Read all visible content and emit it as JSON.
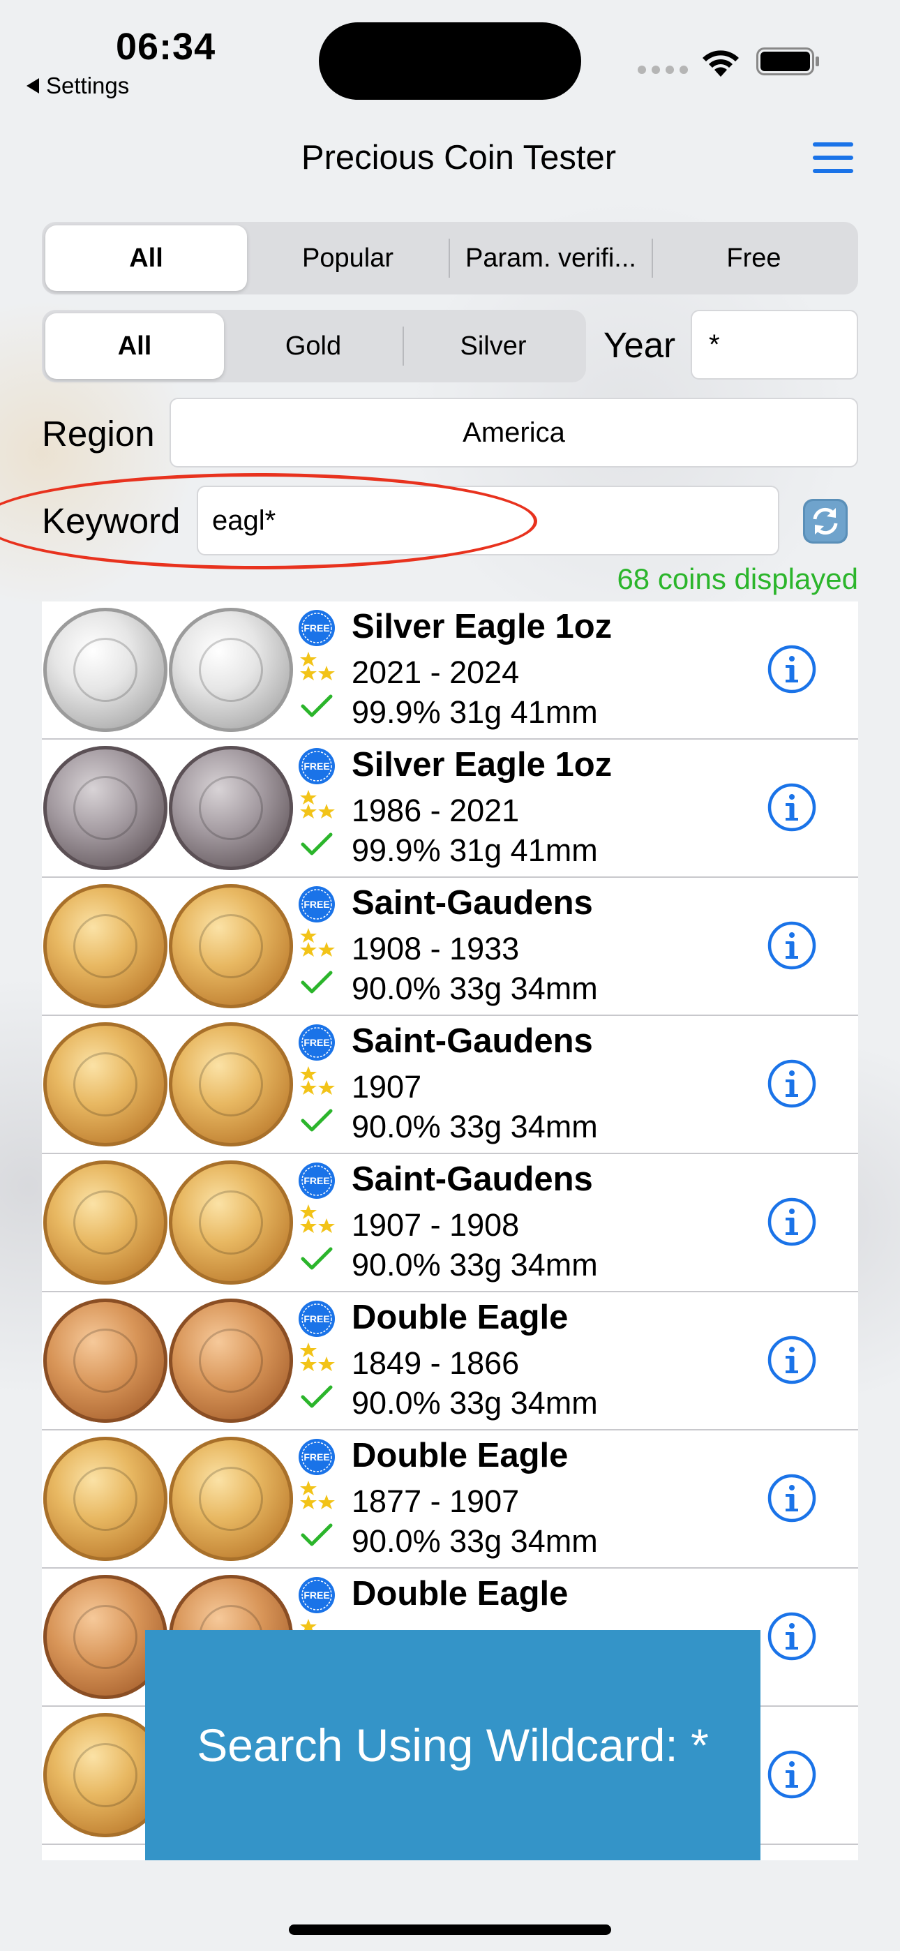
{
  "status_bar": {
    "time": "06:34",
    "back_label": "Settings"
  },
  "header": {
    "title": "Precious Coin Tester"
  },
  "filter_tabs": [
    {
      "label": "All",
      "active": true
    },
    {
      "label": "Popular",
      "active": false
    },
    {
      "label": "Param. verifi...",
      "active": false
    },
    {
      "label": "Free",
      "active": false
    }
  ],
  "metal_tabs": [
    {
      "label": "All",
      "active": true
    },
    {
      "label": "Gold",
      "active": false
    },
    {
      "label": "Silver",
      "active": false
    }
  ],
  "year": {
    "label": "Year",
    "value": "*"
  },
  "region": {
    "label": "Region",
    "value": "America"
  },
  "keyword": {
    "label": "Keyword",
    "value": "eagl*"
  },
  "count_text": "68 coins displayed",
  "badge_text": "FREE",
  "coins": [
    {
      "name": "Silver Eagle 1oz",
      "years": "2021 - 2024",
      "specs": "99.9% 31g 41mm",
      "metal": "silver"
    },
    {
      "name": "Silver Eagle 1oz",
      "years": "1986 - 2021",
      "specs": "99.9% 31g 41mm",
      "metal": "darksilver"
    },
    {
      "name": "Saint-Gaudens",
      "years": "1908 - 1933",
      "specs": "90.0% 33g 34mm",
      "metal": "gold"
    },
    {
      "name": "Saint-Gaudens",
      "years": "1907",
      "specs": "90.0% 33g 34mm",
      "metal": "gold"
    },
    {
      "name": "Saint-Gaudens",
      "years": "1907 - 1908",
      "specs": "90.0% 33g 34mm",
      "metal": "gold"
    },
    {
      "name": "Double Eagle",
      "years": "1849 - 1866",
      "specs": "90.0% 33g 34mm",
      "metal": "redgold"
    },
    {
      "name": "Double Eagle",
      "years": "1877 - 1907",
      "specs": "90.0% 33g 34mm",
      "metal": "gold"
    },
    {
      "name": "Double Eagle",
      "years": "",
      "specs": "",
      "metal": "redgold"
    },
    {
      "name": "",
      "years": "",
      "specs": "",
      "metal": "gold"
    }
  ],
  "toast": {
    "text": "Search Using Wildcard: *"
  },
  "colors": {
    "accent": "#1a73e8",
    "count_green": "#2bb52b",
    "toast_bg": "#3494c8",
    "highlight_red": "#e8321e"
  }
}
